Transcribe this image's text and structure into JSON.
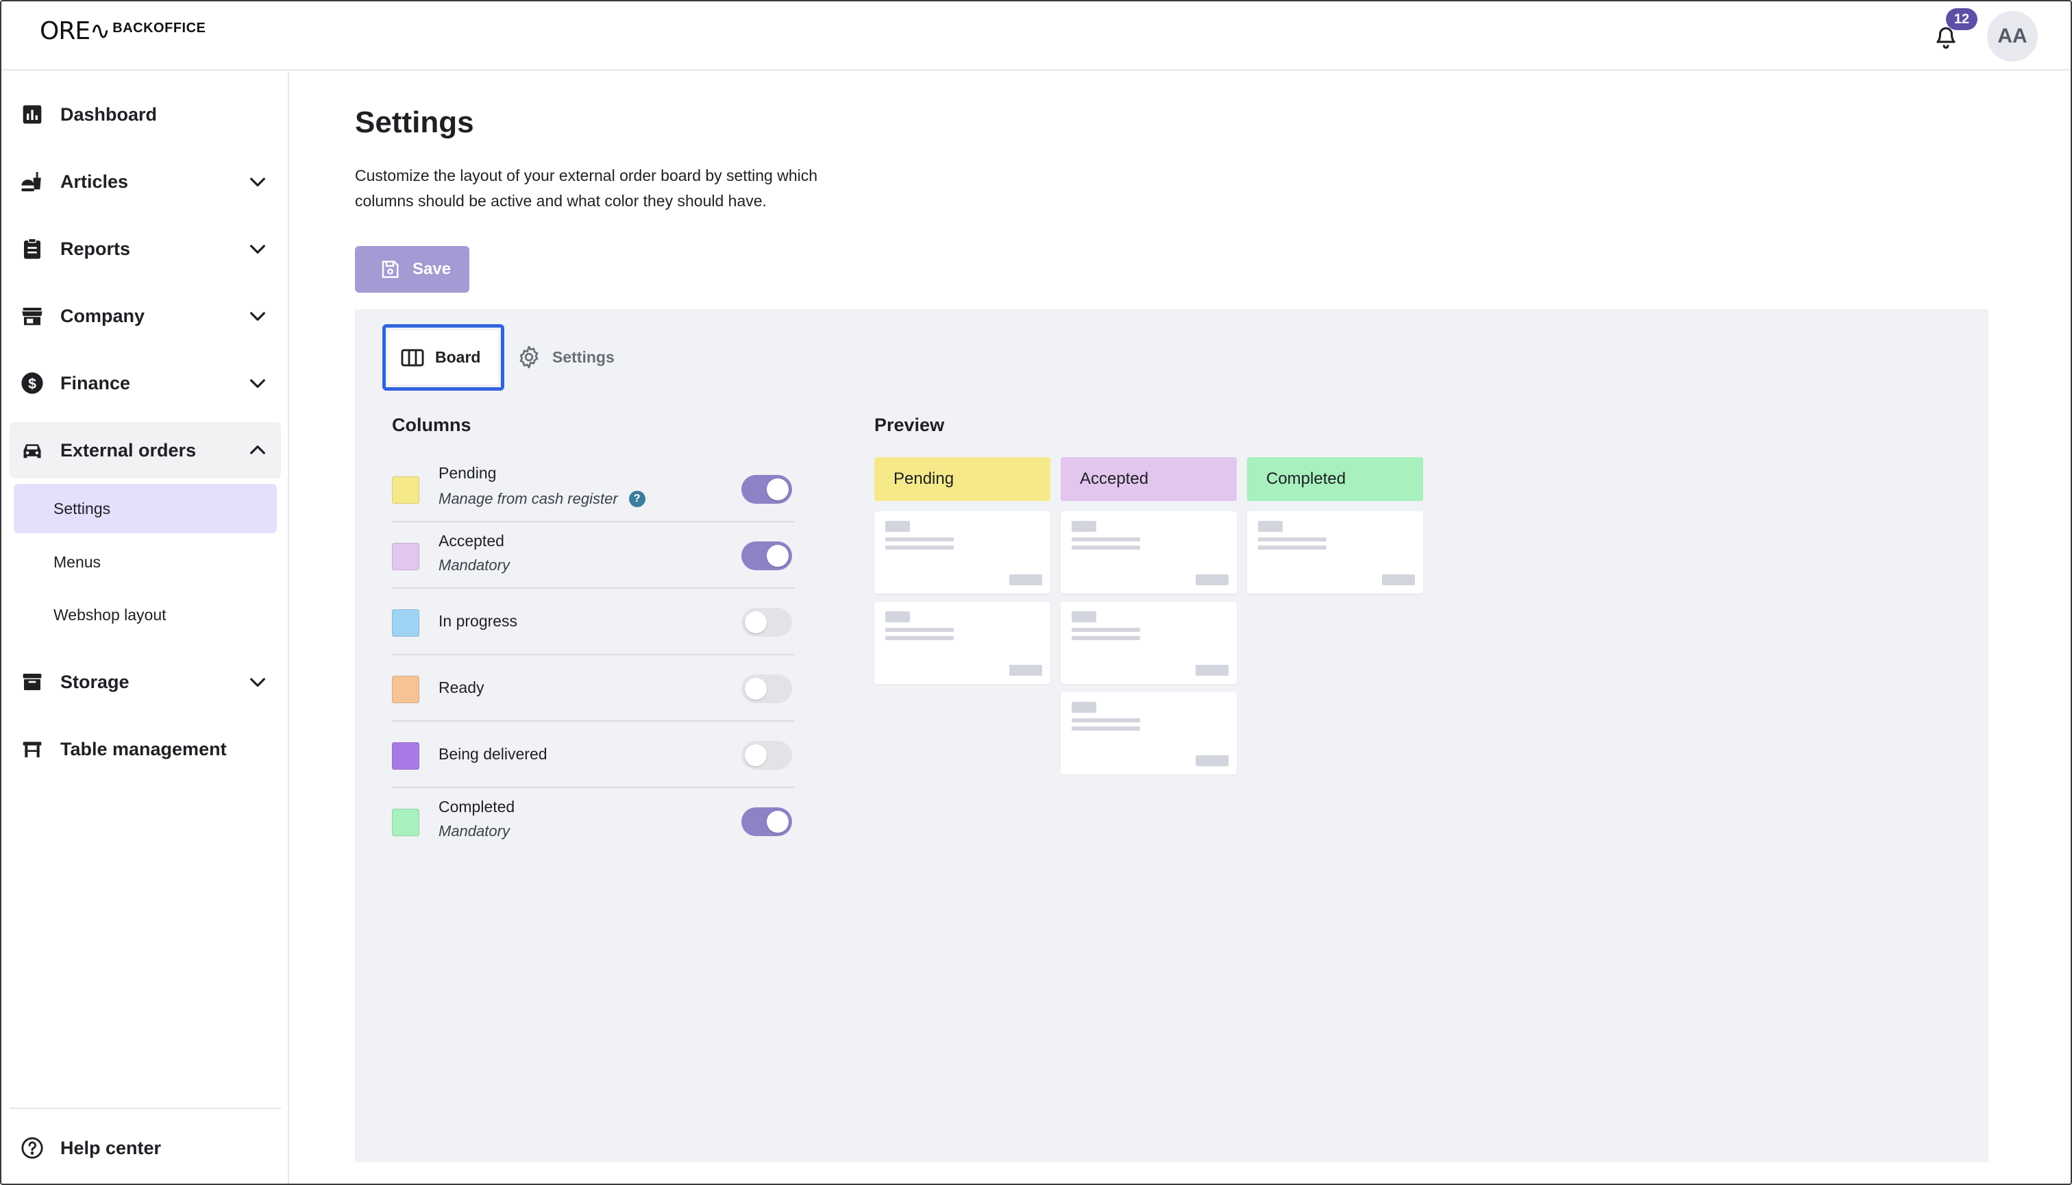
{
  "brand": {
    "logo_mark": "ORE∿",
    "logo_text": "BACKOFFICE"
  },
  "topbar": {
    "notifications_count": "12",
    "avatar_initials": "AA",
    "bell_icon": "bell-icon"
  },
  "sidebar": {
    "items": [
      {
        "label": "Dashboard",
        "icon": "bar-chart-icon"
      },
      {
        "label": "Articles",
        "icon": "food-icon"
      },
      {
        "label": "Reports",
        "icon": "clipboard-icon"
      },
      {
        "label": "Company",
        "icon": "store-icon"
      },
      {
        "label": "Finance",
        "icon": "dollar-circle-icon"
      },
      {
        "label": "External orders",
        "icon": "car-icon"
      },
      {
        "label": "Storage",
        "icon": "archive-icon"
      },
      {
        "label": "Table management",
        "icon": "table-icon"
      }
    ],
    "sub_items": [
      {
        "label": "Settings",
        "selected": true
      },
      {
        "label": "Menus",
        "selected": false
      },
      {
        "label": "Webshop layout",
        "selected": false
      }
    ],
    "help": {
      "label": "Help center",
      "icon": "question-circle-icon"
    }
  },
  "page": {
    "title": "Settings",
    "description": "Customize the layout of your external order board by setting which columns should be active and what color they should have.",
    "save_label": "Save"
  },
  "tabs": [
    {
      "label": "Board",
      "icon": "columns-icon",
      "active": true
    },
    {
      "label": "Settings",
      "icon": "gear-icon",
      "active": false
    }
  ],
  "columns": {
    "title": "Columns",
    "rows": [
      {
        "name": "Pending",
        "sub": "Manage from cash register",
        "help": "?",
        "color": "#f6e98a",
        "enabled": true
      },
      {
        "name": "Accepted",
        "sub": "Mandatory",
        "color": "#e2c6ee",
        "enabled": true
      },
      {
        "name": "In progress",
        "sub": "",
        "color": "#9fd3f3",
        "enabled": false
      },
      {
        "name": "Ready",
        "sub": "",
        "color": "#f6c394",
        "enabled": false
      },
      {
        "name": "Being delivered",
        "sub": "",
        "color": "#a97ae6",
        "enabled": false
      },
      {
        "name": "Completed",
        "sub": "Mandatory",
        "color": "#a8f0be",
        "enabled": true
      }
    ]
  },
  "preview": {
    "title": "Preview",
    "columns": [
      {
        "label": "Pending",
        "color": "#f6e98a",
        "cards": 2
      },
      {
        "label": "Accepted",
        "color": "#e2c6ee",
        "cards": 3
      },
      {
        "label": "Completed",
        "color": "#a8f0be",
        "cards": 1
      }
    ]
  }
}
